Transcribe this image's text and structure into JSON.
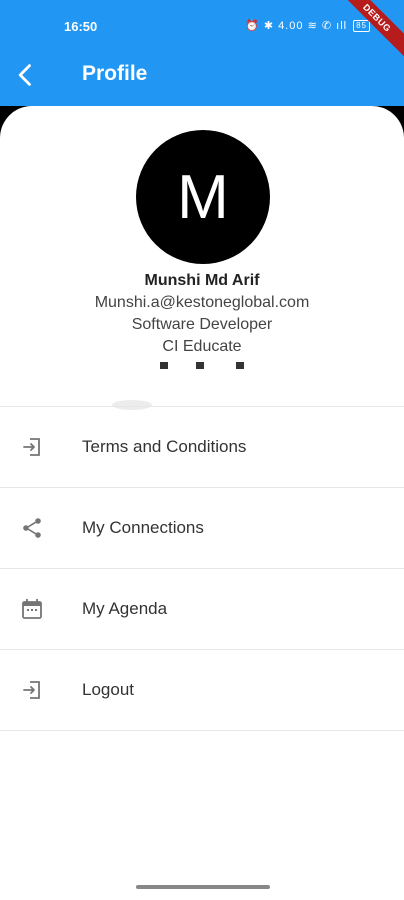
{
  "status_bar": {
    "time": "16:50",
    "icons": "⏰ ✱ 4.00 ≋ ✆ ıll",
    "battery": "85"
  },
  "debug_banner": "DEBUG",
  "app_bar": {
    "title": "Profile",
    "back_icon": "chevron-left-icon"
  },
  "profile": {
    "avatar_letter": "M",
    "name": "Munshi Md  Arif",
    "email": "Munshi.a@kestoneglobal.com",
    "role": "Software Developer",
    "company": "CI Educate"
  },
  "menu": {
    "items": [
      {
        "label": "Terms and Conditions",
        "icon": "login-icon"
      },
      {
        "label": "My Connections",
        "icon": "share-icon"
      },
      {
        "label": "My Agenda",
        "icon": "calendar-icon"
      },
      {
        "label": "Logout",
        "icon": "logout-icon"
      }
    ]
  },
  "colors": {
    "primary": "#2196F3",
    "icon_gray": "#757575"
  }
}
